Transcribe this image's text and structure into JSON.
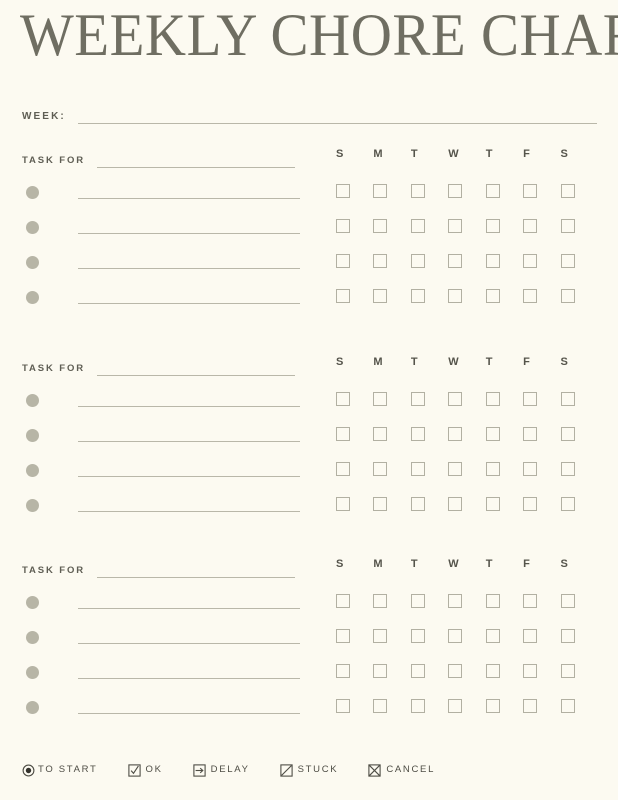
{
  "document": {
    "title": "WEEKLY CHORE CHART",
    "background_color": "#FCFAF1",
    "ink_color": "#6F6E62",
    "line_color": "#B9B7A9",
    "bullet_color": "#B7B5A6"
  },
  "week_field": {
    "label": "WEEK:",
    "value": ""
  },
  "sections": [
    {
      "label": "TASK FOR",
      "assignee": "",
      "days": [
        "S",
        "M",
        "T",
        "W",
        "T",
        "F",
        "S"
      ],
      "rows": [
        {
          "task": "",
          "checks": [
            "",
            "",
            "",
            "",
            "",
            "",
            ""
          ]
        },
        {
          "task": "",
          "checks": [
            "",
            "",
            "",
            "",
            "",
            "",
            ""
          ]
        },
        {
          "task": "",
          "checks": [
            "",
            "",
            "",
            "",
            "",
            "",
            ""
          ]
        },
        {
          "task": "",
          "checks": [
            "",
            "",
            "",
            "",
            "",
            "",
            ""
          ]
        }
      ]
    },
    {
      "label": "TASK FOR",
      "assignee": "",
      "days": [
        "S",
        "M",
        "T",
        "W",
        "T",
        "F",
        "S"
      ],
      "rows": [
        {
          "task": "",
          "checks": [
            "",
            "",
            "",
            "",
            "",
            "",
            ""
          ]
        },
        {
          "task": "",
          "checks": [
            "",
            "",
            "",
            "",
            "",
            "",
            ""
          ]
        },
        {
          "task": "",
          "checks": [
            "",
            "",
            "",
            "",
            "",
            "",
            ""
          ]
        },
        {
          "task": "",
          "checks": [
            "",
            "",
            "",
            "",
            "",
            "",
            ""
          ]
        }
      ]
    },
    {
      "label": "TASK FOR",
      "assignee": "",
      "days": [
        "S",
        "M",
        "T",
        "W",
        "T",
        "F",
        "S"
      ],
      "rows": [
        {
          "task": "",
          "checks": [
            "",
            "",
            "",
            "",
            "",
            "",
            ""
          ]
        },
        {
          "task": "",
          "checks": [
            "",
            "",
            "",
            "",
            "",
            "",
            ""
          ]
        },
        {
          "task": "",
          "checks": [
            "",
            "",
            "",
            "",
            "",
            "",
            ""
          ]
        },
        {
          "task": "",
          "checks": [
            "",
            "",
            "",
            "",
            "",
            "",
            ""
          ]
        }
      ]
    }
  ],
  "legend": [
    {
      "label": "TO START",
      "icon": "radio-filled-icon"
    },
    {
      "label": "OK",
      "icon": "checkbox-checked-icon"
    },
    {
      "label": "DELAY",
      "icon": "arrow-right-box-icon"
    },
    {
      "label": "STUCK",
      "icon": "slash-box-icon"
    },
    {
      "label": "CANCEL",
      "icon": "x-box-icon"
    }
  ]
}
